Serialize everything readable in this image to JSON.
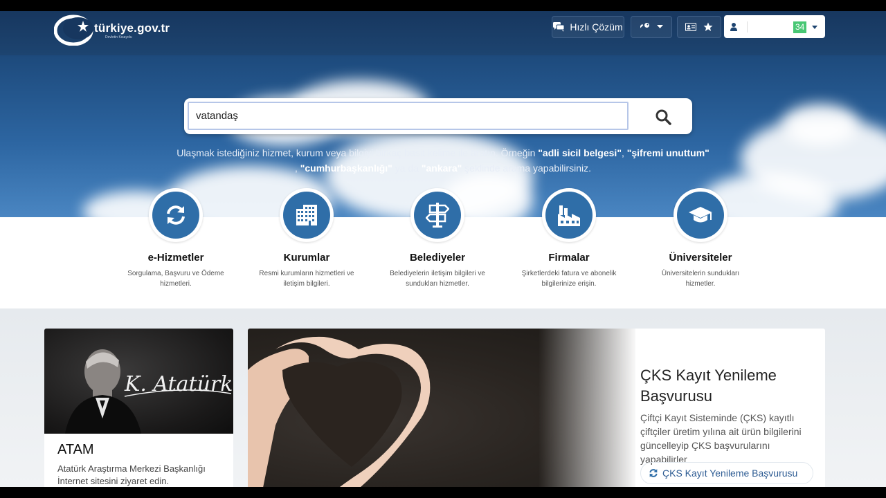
{
  "header": {
    "logo_text": "türkiye.gov.tr",
    "logo_tagline": "Devletin Kısayolu",
    "quick_solution_label": "Hızlı Çözüm",
    "user_badge_suffix": "34"
  },
  "search": {
    "value": "vatandaş",
    "help_text": {
      "part1": "Ulaşmak istediğiniz hizmet, kurum veya bilgiyi birkaç basit kelime ile aratın. Örneğin ",
      "ex1": "\"adli sicil belgesi\"",
      "sep1": ", ",
      "ex2": "\"şifremi unuttum\"",
      "sep2": ", ",
      "ex3": "\"cumhurbaşkanlığı\"",
      "sep3": " ya da ",
      "ex4": "\"ankara\"",
      "part2": " şeklinde arama yapabilirsiniz."
    }
  },
  "categories": [
    {
      "title": "e-Hizmetler",
      "desc": "Sorgulama, Başvuru ve Ödeme hizmetleri.",
      "icon": "refresh-icon"
    },
    {
      "title": "Kurumlar",
      "desc": "Resmi kurumların hizmetleri ve iletişim bilgileri.",
      "icon": "building-icon"
    },
    {
      "title": "Belediyeler",
      "desc": "Belediyelerin iletişim bilgileri ve sundukları hizmetler.",
      "icon": "signpost-icon"
    },
    {
      "title": "Firmalar",
      "desc": "Şirketlerdeki fatura ve abonelik bilgilerinize erişin.",
      "icon": "factory-icon"
    },
    {
      "title": "Üniversiteler",
      "desc": "Üniversitelerin sundukları hizmetler.",
      "icon": "graduation-cap-icon"
    }
  ],
  "atam_card": {
    "signature": "K. Atatürk",
    "title": "ATAM",
    "desc": "Atatürk Araştırma Merkezi Başkanlığı İnternet sitesini ziyaret edin."
  },
  "promo": {
    "title": "ÇKS Kayıt Yenileme Başvurusu",
    "desc": "Çiftçi Kayıt Sisteminde (ÇKS) kayıtlı çiftçiler üretim yılına ait ürün bilgilerini güncelleyip ÇKS başvurularını yapabilirler",
    "link_label": "ÇKS Kayıt Yenileme Başvurusu"
  },
  "colors": {
    "header_bg": "#17375f",
    "accent_blue": "#2f6ea8",
    "badge_green": "#48c774"
  }
}
